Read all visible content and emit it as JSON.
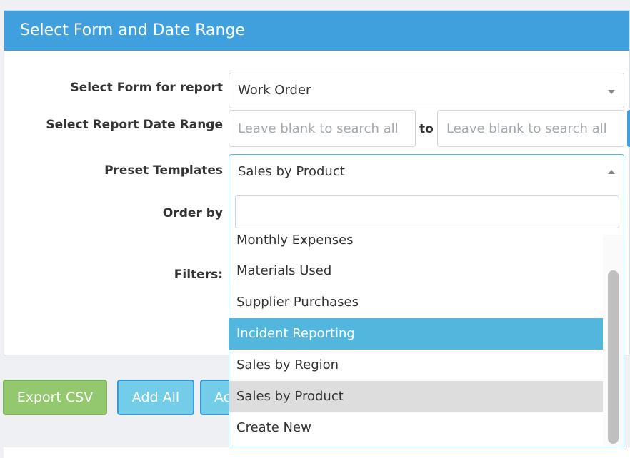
{
  "panel": {
    "title": "Select Form and Date Range"
  },
  "form": {
    "form_label": "Select Form for report",
    "form_value": "Work Order",
    "date_label": "Select Report Date Range",
    "date_from_placeholder": "Leave blank to search all",
    "date_to_label": "to",
    "date_to_placeholder": "Leave blank to search all",
    "preset_label": "Preset Templates",
    "preset_value": "Sales by Product",
    "order_label": "Order by",
    "filters_label": "Filters:"
  },
  "dropdown": {
    "search_placeholder": "",
    "options": [
      "Monthly Expenses",
      "Materials Used",
      "Supplier Purchases",
      "Incident Reporting",
      "Sales by Region",
      "Sales by Product",
      "Create New"
    ],
    "highlighted": "Incident Reporting",
    "selected": "Sales by Product"
  },
  "buttons": {
    "export_csv": "Export CSV",
    "add_all": "Add All",
    "third_partial": "Ac"
  },
  "colors": {
    "header": "#409fdd",
    "highlight": "#53b7dd",
    "green_button": "#94c86f",
    "blue_button": "#73cce8"
  }
}
